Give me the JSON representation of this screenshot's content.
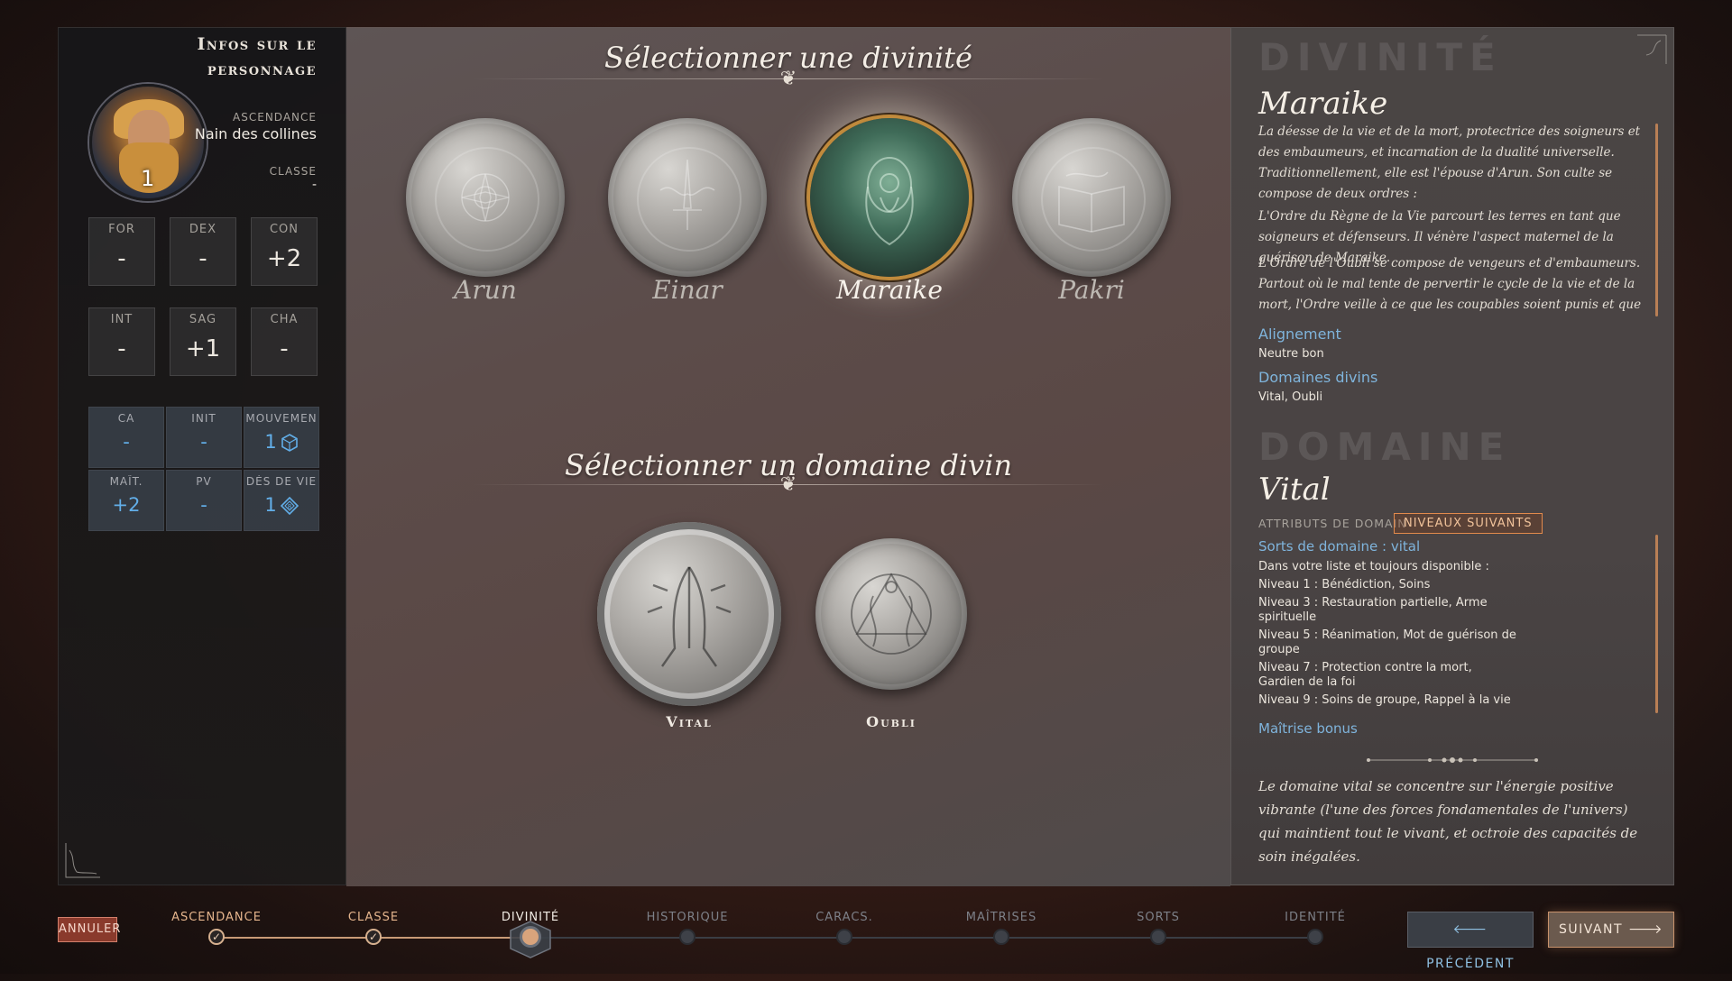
{
  "character": {
    "title": "Infos sur le personnage",
    "ancestry_label": "ASCENDANCE",
    "ancestry_value": "Nain des collines",
    "class_label": "CLASSE",
    "class_value": "-",
    "level": "1",
    "abilities": [
      {
        "label": "FOR",
        "value": "-"
      },
      {
        "label": "DEX",
        "value": "-"
      },
      {
        "label": "CON",
        "value": "+2"
      },
      {
        "label": "INT",
        "value": "-"
      },
      {
        "label": "SAG",
        "value": "+1"
      },
      {
        "label": "CHA",
        "value": "-"
      }
    ],
    "combat": [
      {
        "label": "CA",
        "value": "-"
      },
      {
        "label": "INIT",
        "value": "-"
      },
      {
        "label": "MOUVEMEN",
        "value": "1"
      },
      {
        "label": "MAÎT.",
        "value": "+2"
      },
      {
        "label": "PV",
        "value": "-"
      },
      {
        "label": "DÉS DE VIE",
        "value": "1"
      }
    ]
  },
  "deity_section": {
    "title": "Sélectionner une divinité",
    "deities": [
      "Arun",
      "Einar",
      "Maraike",
      "Pakri"
    ],
    "selected": "Maraike"
  },
  "domain_section": {
    "title": "Sélectionner un domaine divin",
    "domains": [
      "Vital",
      "Oubli"
    ],
    "selected": "Vital"
  },
  "details": {
    "deity_header": "DIVINITÉ",
    "deity_name": "Maraike",
    "deity_desc": [
      "La déesse de la vie et de la mort, protectrice des soigneurs et des embaumeurs, et incarnation de la dualité universelle. Traditionnellement, elle est l'épouse d'Arun. Son culte se compose de deux ordres :",
      "L'Ordre du Règne de la Vie parcourt les terres en tant que soigneurs et défenseurs. Il vénère l'aspect maternel de la guérison de Maraike.",
      "L'Ordre de l'Oubli se compose de vengeurs et d'embaumeurs. Partout où le mal tente de pervertir le cycle de la vie et de la mort, l'Ordre veille à ce que les coupables soient punis et que leurs victimes mort-"
    ],
    "alignment_label": "Alignement",
    "alignment_value": "Neutre bon",
    "domains_label": "Domaines divins",
    "domains_value": "Vital, Oubli",
    "domain_header": "DOMAINE",
    "domain_name": "Vital",
    "domain_attrs_label": "ATTRIBUTS DE DOMAIN",
    "next_levels_button": "NIVEAUX SUIVANTS",
    "domain_spells_label": "Sorts de domaine : vital",
    "domain_spells": [
      "Dans votre liste et toujours disponible :",
      "Niveau 1 : Bénédiction, Soins",
      "Niveau 3 : Restauration partielle, Arme spirituelle",
      "Niveau 5 : Réanimation, Mot de guérison de groupe",
      "Niveau 7 : Protection contre la mort, Gardien de la foi",
      "Niveau 9 : Soins de groupe, Rappel à la vie"
    ],
    "bonus_label": "Maîtrise bonus",
    "domain_desc": "Le domaine vital se concentre sur l'énergie positive vibrante (l'une des forces fondamentales de l'univers) qui maintient tout le vivant, et octroie des capacités de soin inégalées."
  },
  "footer": {
    "cancel": "ANNULER",
    "steps": [
      "ASCENDANCE",
      "CLASSE",
      "DIVINITÉ",
      "HISTORIQUE",
      "CARACS.",
      "MAÎTRISES",
      "SORTS",
      "IDENTITÉ"
    ],
    "current_step": "DIVINITÉ",
    "prev": "PRÉCÉDENT",
    "next": "SUIVANT"
  },
  "icons": {
    "movement": "d6-die-icon",
    "hit_dice": "d8-die-icon",
    "prev_arrow": "arrow-left-icon",
    "next_arrow": "arrow-right-icon",
    "step_done": "checkmark-icon"
  },
  "colors": {
    "accent_blue": "#62aee8",
    "selection_gold": "#c08a3c",
    "cancel_red": "#8a3a2c"
  }
}
